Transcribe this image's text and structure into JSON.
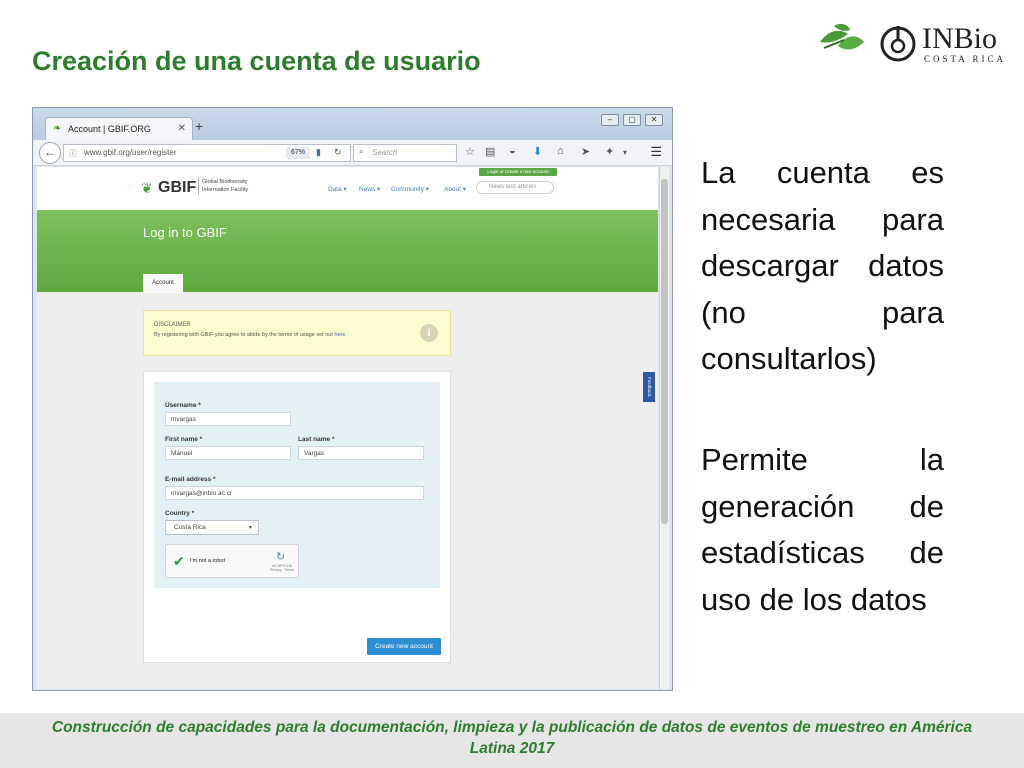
{
  "slide": {
    "title": "Creación de una cuenta de usuario",
    "logo": {
      "name": "INBio",
      "subtitle": "COSTA RICA"
    },
    "paragraphs": [
      "La cuenta es necesaria para descargar datos (no para consultarlos)",
      "Permite la generación de estadísticas de uso de los datos"
    ],
    "footer": "Construcción de capacidades para la documentación, limpieza y la publicación de datos de eventos de muestreo en América Latina 2017"
  },
  "browser": {
    "tab_title": "Account | GBIF.ORG",
    "url": "www.gbif.org/user/register",
    "zoom": "67%",
    "search_placeholder": "Search"
  },
  "gbif": {
    "logo_text": "GBIF",
    "logo_subtitle_1": "Global Biodiversity",
    "logo_subtitle_2": "Information Facility",
    "nav": [
      "Data ▾",
      "News ▾",
      "Community ▾",
      "About ▾"
    ],
    "search_placeholder": "News and articles",
    "login_link": "Login or Create a new account",
    "page_heading": "Log in to GBIF",
    "tab_account": "Account",
    "disclaimer_title": "DISCLAIMER",
    "disclaimer_text": "By registering with GBIF you agree to abide by the terms of usage set out",
    "disclaimer_link": "here.",
    "feedback": "Feedback",
    "form": {
      "username_label": "Username *",
      "username_value": "mvargas",
      "first_name_label": "First name *",
      "first_name_value": "Manuel",
      "last_name_label": "Last name *",
      "last_name_value": "Vargas",
      "email_label": "E-mail address *",
      "email_value": "mvargas@inbio.ac.cr",
      "country_label": "Country *",
      "country_value": "Costa Rica",
      "captcha_label": "I'm not a robot",
      "captcha_brand": "reCAPTCHA",
      "captcha_terms": "Privacy - Terms",
      "submit_label": "Create new account"
    }
  }
}
